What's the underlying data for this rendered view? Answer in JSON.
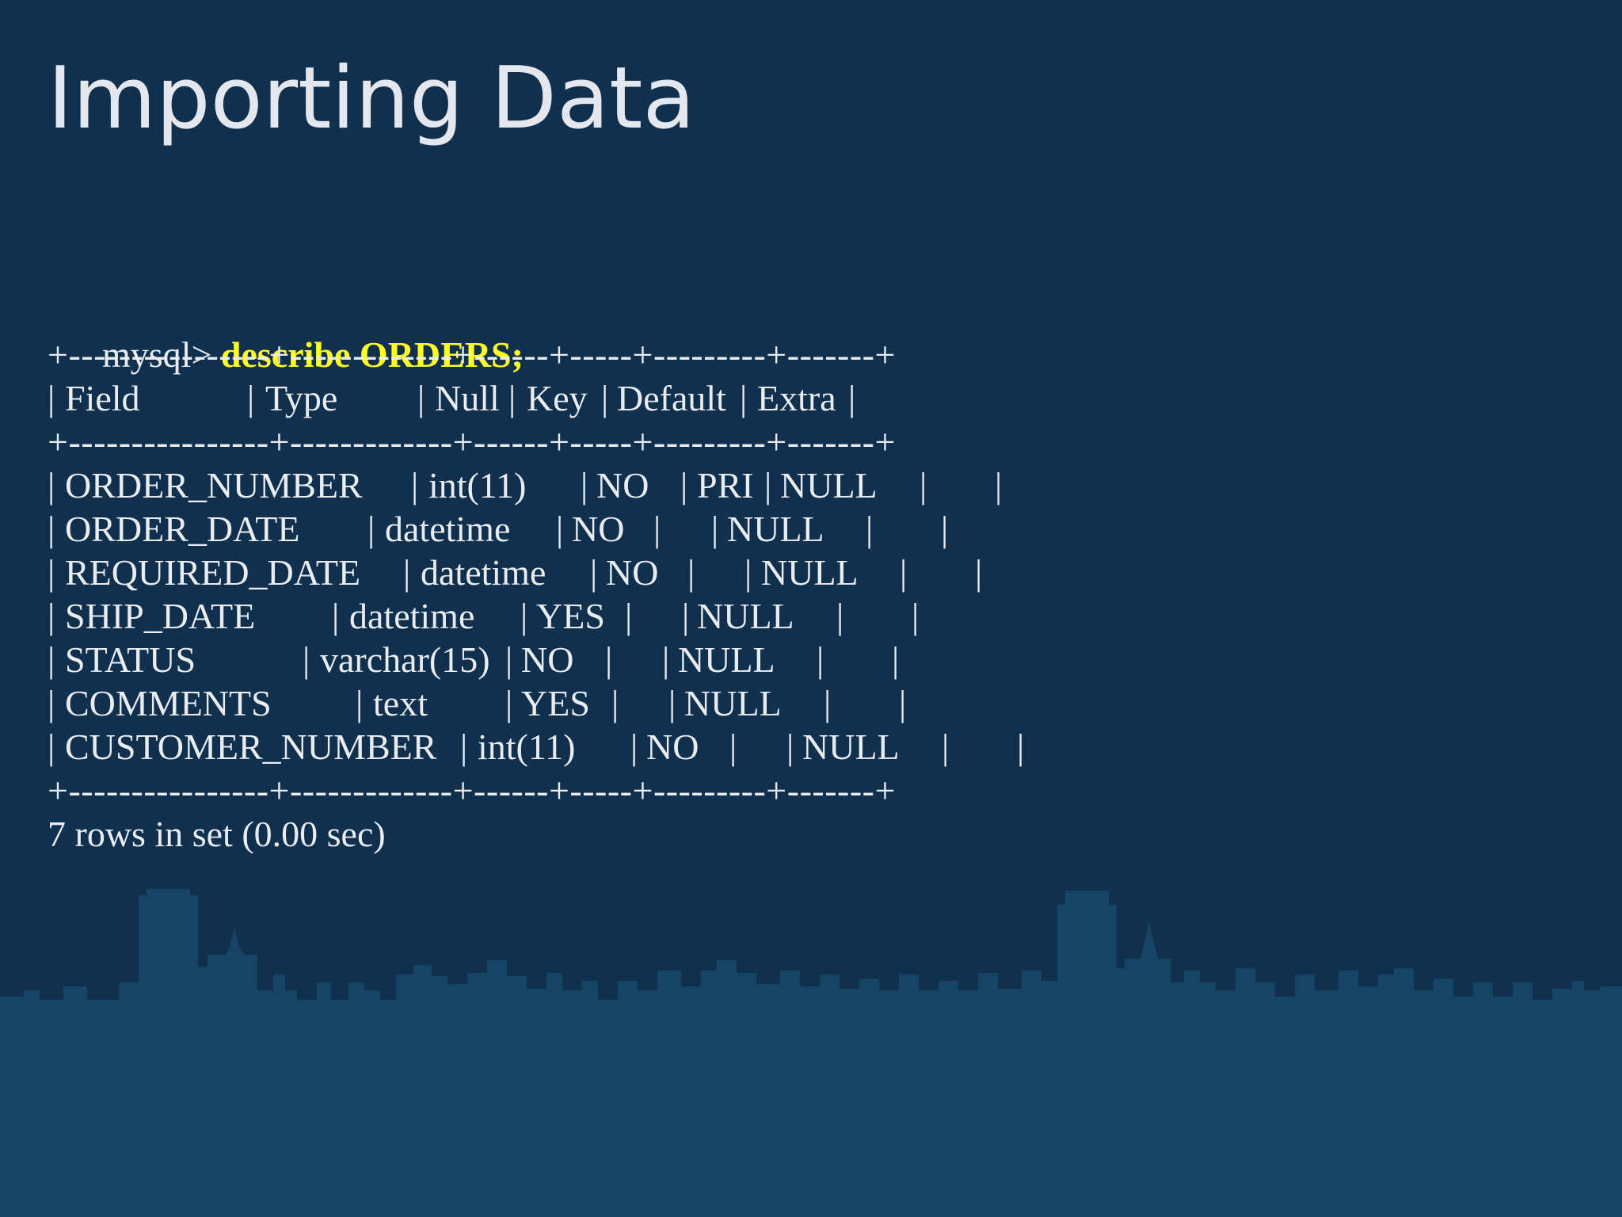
{
  "slide": {
    "title": "Importing Data",
    "background_color": "#10304d",
    "skyline_color": "#154465"
  },
  "console": {
    "prompt": "mysql>",
    "command": "describe ORDERS;",
    "command_color": "#ffff22",
    "border": "+----------------+-------------+------+-----+---------+-------+",
    "header": [
      "Field",
      "Type",
      "Null",
      "Key",
      "Default",
      "Extra"
    ],
    "rows": [
      [
        "ORDER_NUMBER",
        "int(11)",
        "NO",
        "PRI",
        "NULL",
        ""
      ],
      [
        "ORDER_DATE",
        "datetime",
        "NO",
        "",
        "NULL",
        ""
      ],
      [
        "REQUIRED_DATE",
        "datetime",
        "NO",
        "",
        "NULL",
        ""
      ],
      [
        "SHIP_DATE",
        "datetime",
        "YES",
        "",
        "NULL",
        ""
      ],
      [
        "STATUS",
        "varchar(15)",
        "NO",
        "",
        "NULL",
        ""
      ],
      [
        "COMMENTS",
        "text",
        "YES",
        "",
        "NULL",
        ""
      ],
      [
        "CUSTOMER_NUMBER",
        "int(11)",
        "NO",
        "",
        "NULL",
        ""
      ]
    ],
    "footer": "7 rows in set (0.00 sec)"
  }
}
